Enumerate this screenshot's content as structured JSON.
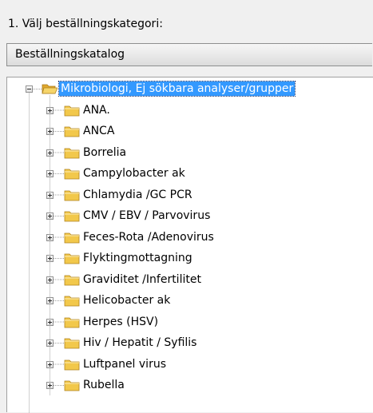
{
  "step": {
    "label": "1. Välj beställningskategori:"
  },
  "category_select": {
    "value": "Beställningskatalog"
  },
  "tree": {
    "root": {
      "label": "Mikrobiologi, Ej sökbara analyser/grupper",
      "expanded": true,
      "selected": true,
      "icon": "folder-open-icon",
      "children": [
        "ANA.",
        "ANCA",
        "Borrelia",
        "Campylobacter ak",
        "Chlamydia /GC PCR",
        "CMV / EBV / Parvovirus",
        "Feces-Rota /Adenovirus",
        "Flyktingmottagning",
        "Graviditet /Infertilitet",
        "Helicobacter ak",
        "Herpes (HSV)",
        "Hiv / Hepatit / Syfilis",
        "Luftpanel virus",
        "Rubella"
      ]
    }
  },
  "colors": {
    "folder": "#f2c84b",
    "selection": "#3399ff",
    "window_background": "#f0f0f0"
  }
}
